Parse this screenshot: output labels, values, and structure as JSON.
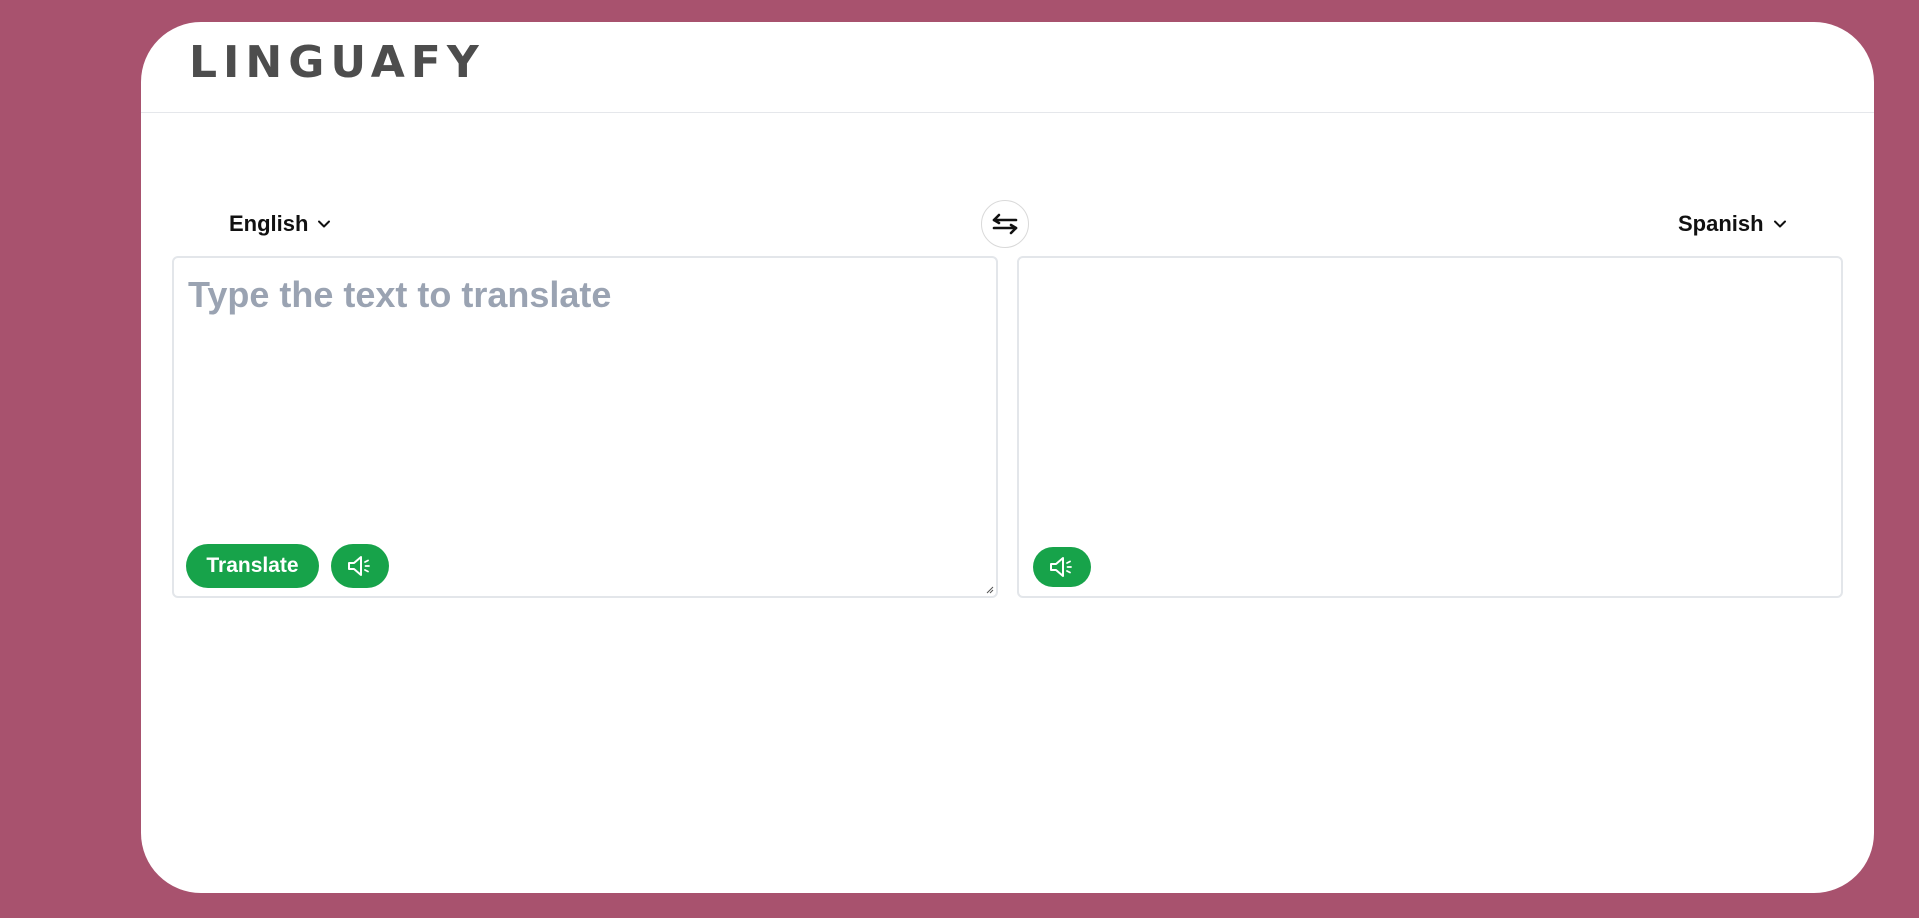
{
  "app": {
    "logo": "LINGUAFY"
  },
  "source": {
    "language": "English",
    "placeholder": "Type the text to translate",
    "value": "",
    "translate_label": "Translate"
  },
  "target": {
    "language": "Spanish",
    "output": ""
  },
  "icons": {
    "swap": "swap-arrows-icon",
    "speak": "speaker-icon",
    "chevron": "chevron-down-icon"
  },
  "colors": {
    "background": "#a8526e",
    "accent": "#17a34a",
    "logo": "#4d4d4d",
    "placeholder": "#9aa3b2"
  }
}
